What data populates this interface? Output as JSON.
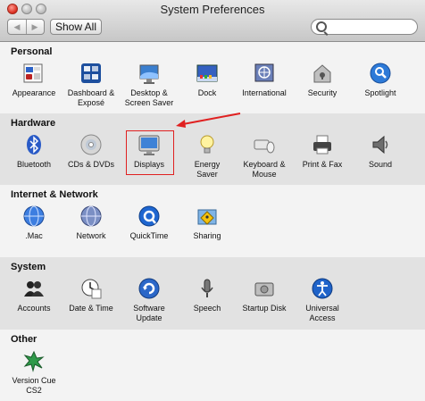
{
  "window": {
    "title": "System Preferences"
  },
  "toolbar": {
    "back_glyph": "◀",
    "forward_glyph": "▶",
    "show_all_label": "Show All",
    "search": {
      "value": "",
      "placeholder": ""
    }
  },
  "sections": {
    "personal": {
      "title": "Personal",
      "items": [
        {
          "label": "Appearance",
          "icon": "appearance-icon"
        },
        {
          "label": "Dashboard &\nExposé",
          "icon": "dashboard-expose-icon"
        },
        {
          "label": "Desktop &\nScreen Saver",
          "icon": "desktop-screensaver-icon"
        },
        {
          "label": "Dock",
          "icon": "dock-icon"
        },
        {
          "label": "International",
          "icon": "international-icon"
        },
        {
          "label": "Security",
          "icon": "security-icon"
        },
        {
          "label": "Spotlight",
          "icon": "spotlight-icon"
        }
      ]
    },
    "hardware": {
      "title": "Hardware",
      "items": [
        {
          "label": "Bluetooth",
          "icon": "bluetooth-icon"
        },
        {
          "label": "CDs & DVDs",
          "icon": "cds-dvds-icon"
        },
        {
          "label": "Displays",
          "icon": "displays-icon"
        },
        {
          "label": "Energy\nSaver",
          "icon": "energy-saver-icon"
        },
        {
          "label": "Keyboard &\nMouse",
          "icon": "keyboard-mouse-icon"
        },
        {
          "label": "Print & Fax",
          "icon": "print-fax-icon"
        },
        {
          "label": "Sound",
          "icon": "sound-icon"
        }
      ]
    },
    "internet": {
      "title": "Internet & Network",
      "items": [
        {
          "label": ".Mac",
          "icon": "mac-icon"
        },
        {
          "label": "Network",
          "icon": "network-icon"
        },
        {
          "label": "QuickTime",
          "icon": "quicktime-icon"
        },
        {
          "label": "Sharing",
          "icon": "sharing-icon"
        }
      ]
    },
    "system": {
      "title": "System",
      "items": [
        {
          "label": "Accounts",
          "icon": "accounts-icon"
        },
        {
          "label": "Date & Time",
          "icon": "date-time-icon"
        },
        {
          "label": "Software\nUpdate",
          "icon": "software-update-icon"
        },
        {
          "label": "Speech",
          "icon": "speech-icon"
        },
        {
          "label": "Startup Disk",
          "icon": "startup-disk-icon"
        },
        {
          "label": "Universal\nAccess",
          "icon": "universal-access-icon"
        }
      ]
    },
    "other": {
      "title": "Other",
      "items": [
        {
          "label": "Version Cue\nCS2",
          "icon": "version-cue-icon"
        }
      ]
    }
  },
  "colors": {
    "highlight_border": "#e02020",
    "arrow": "#e02020"
  }
}
